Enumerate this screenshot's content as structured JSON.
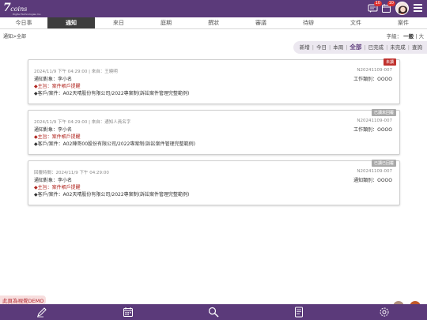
{
  "header": {
    "brand_mark": "7",
    "brand_word": "coins",
    "brand_sub": "Digital Technologies Inc.",
    "badges": {
      "messages": "10",
      "calendar": "10"
    }
  },
  "tabs": [
    "今日事",
    "通知",
    "來日",
    "庭期",
    "撰狀",
    "審議",
    "待辦",
    "文件",
    "案件"
  ],
  "active_tab": 1,
  "breadcrumb": "通知>全部",
  "font_size": {
    "label": "字級：",
    "normal": "一般",
    "sep": "|",
    "large": "大"
  },
  "filters": [
    "新增",
    "今日",
    "本周",
    "全部",
    "已完成",
    "未完成",
    "查詢"
  ],
  "active_filter": 3,
  "cards": [
    {
      "meta": "2024/11/9 下午 04:29:00  |  來自：王曉明",
      "recipient": "通知對象：李小名",
      "subject": "◆主旨：案件帳戶提醒",
      "case": "◆客戶/案件：A02天晴股份有限公司/2022專案制(訴訟案件管理完整範例)",
      "number": "N20241109-007",
      "type": "工作類別：OOOO",
      "tag": "未讀",
      "tag_kind": "unread"
    },
    {
      "meta": "2024/11/9 下午 04:29:00  |  來自：通知人員名字",
      "recipient": "通知對象：李小名",
      "subject": "◆主旨：案件帳戶提醒",
      "case": "◆客戶/案件：A02陣哥00股份有限公司/2022專案制(訴訟案件管理完整範例)",
      "number": "N20241109-007",
      "type": "工作類別：OOOO",
      "tag": "已讀未回覆",
      "tag_kind": "read"
    },
    {
      "meta": "回覆時間：2024/11/9 下午 04:29:00",
      "recipient": "通知對象：李小名",
      "subject": "◆主旨：案件帳戶提醒",
      "case": "◆客戶/案件：A02天晴股份有限公司/2022專案制(訴訟案件管理完整範例)",
      "number": "N20241109-007",
      "type": "通知類別：OOOO",
      "tag": "已讀已回覆",
      "tag_kind": "read"
    }
  ],
  "demo_label": "此頁為視覺DEMO",
  "bottom_nav": [
    "edit-icon",
    "calendar-icon",
    "search-icon",
    "document-icon",
    "settings-icon"
  ],
  "colors": {
    "brand": "#5b3a7a",
    "unread": "#c0322f",
    "read_tag": "#a9a9a9",
    "subject": "#b0251f"
  }
}
